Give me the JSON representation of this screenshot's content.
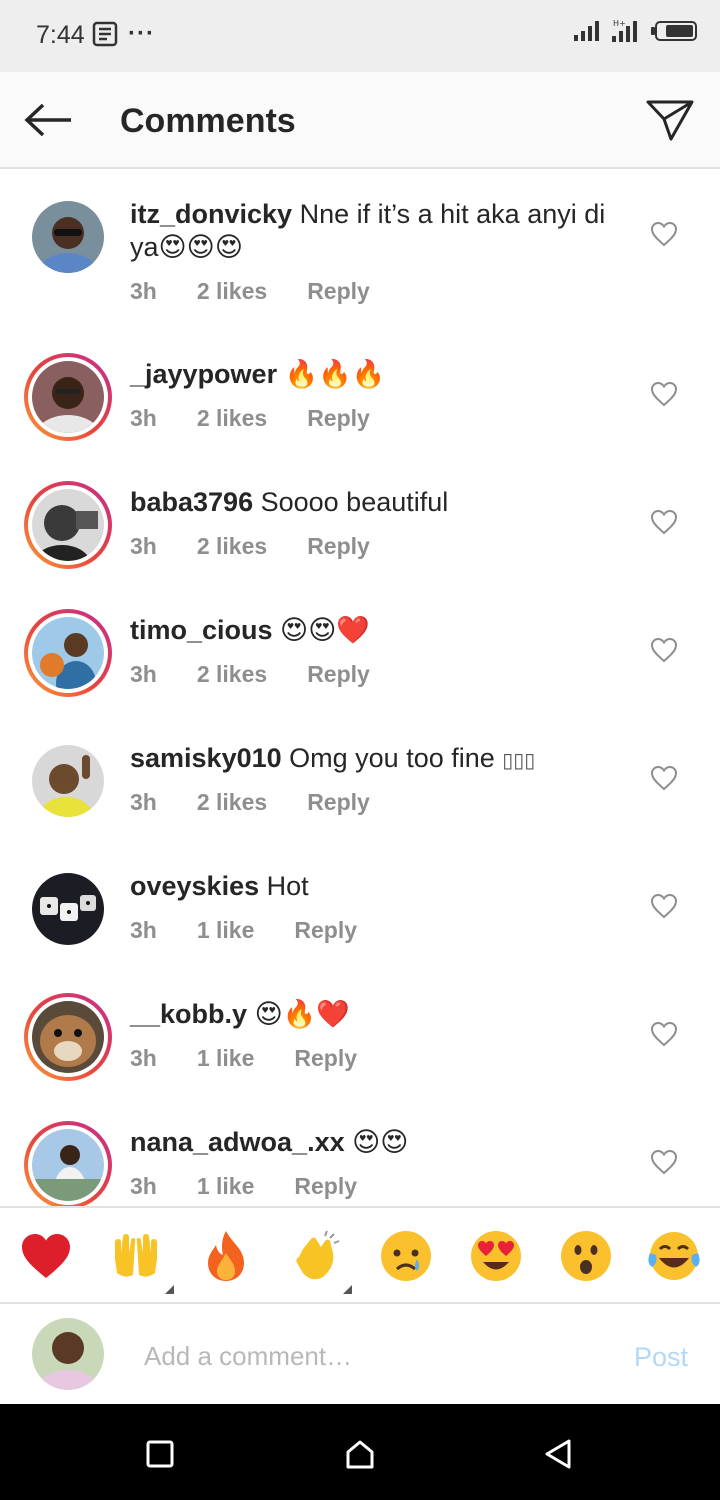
{
  "status_bar": {
    "time": "7:44",
    "more": "···"
  },
  "header": {
    "title": "Comments"
  },
  "comments": [
    {
      "username": "itz_donvicky",
      "text": "Nne if it’s a hit aka anyi di ya",
      "emojis": "😍😍😍",
      "time": "3h",
      "likes": "2 likes",
      "reply": "Reply",
      "ring": false
    },
    {
      "username": "_jayypower",
      "text": "",
      "emojis": "🔥🔥🔥",
      "time": "3h",
      "likes": "2 likes",
      "reply": "Reply",
      "ring": true
    },
    {
      "username": "baba3796",
      "text": "Soooo beautiful",
      "emojis": "",
      "time": "3h",
      "likes": "2 likes",
      "reply": "Reply",
      "ring": true
    },
    {
      "username": "timo_cious",
      "text": "",
      "emojis": "😍😍❤️",
      "time": "3h",
      "likes": "2 likes",
      "reply": "Reply",
      "ring": true
    },
    {
      "username": "samisky010",
      "text": "Omg you too fine",
      "emojis": "▯▯▯",
      "time": "3h",
      "likes": "2 likes",
      "reply": "Reply",
      "ring": false
    },
    {
      "username": "oveyskies",
      "text": "Hot",
      "emojis": "",
      "time": "3h",
      "likes": "1 like",
      "reply": "Reply",
      "ring": false
    },
    {
      "username": "__kobb.y",
      "text": "",
      "emojis": "😍🔥❤️",
      "time": "3h",
      "likes": "1 like",
      "reply": "Reply",
      "ring": true
    },
    {
      "username": "nana_adwoa_.xx",
      "text": "",
      "emojis": "😍😍",
      "time": "3h",
      "likes": "1 like",
      "reply": "Reply",
      "ring": true
    }
  ],
  "quick_emojis": [
    "❤️",
    "🙌",
    "🔥",
    "👏",
    "😢",
    "😍",
    "😮",
    "😂"
  ],
  "composer": {
    "placeholder": "Add a comment…",
    "post_label": "Post"
  },
  "colors": {
    "accent_post": "#b3d8f7",
    "meta_gray": "#8e8e8e",
    "ring_gradient": [
      "#f9a23a",
      "#e8443a",
      "#c42c8f"
    ]
  }
}
